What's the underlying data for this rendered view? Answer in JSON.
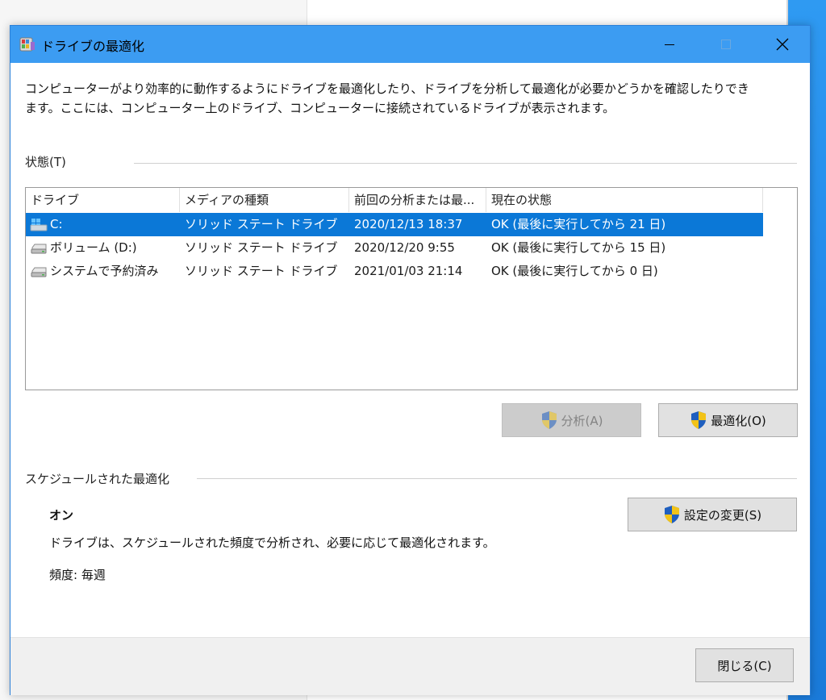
{
  "window": {
    "title": "ドライブの最適化",
    "description": "コンピューターがより効率的に動作するようにドライブを最適化したり、ドライブを分析して最適化が必要かどうかを確認したりできます。ここには、コンピューター上のドライブ、コンピューターに接続されているドライブが表示されます。"
  },
  "status_section": {
    "label": "状態(T)",
    "columns": [
      "ドライブ",
      "メディアの種類",
      "前回の分析または最...",
      "現在の状態"
    ],
    "rows": [
      {
        "drive": "C:",
        "media": "ソリッド ステート ドライブ",
        "last_run": "2020/12/13 18:37",
        "status": "OK (最後に実行してから 21 日)",
        "icon": "windows-drive-icon",
        "selected": true
      },
      {
        "drive": "ボリューム (D:)",
        "media": "ソリッド ステート ドライブ",
        "last_run": "2020/12/20 9:55",
        "status": "OK (最後に実行してから 15 日)",
        "icon": "drive-icon",
        "selected": false
      },
      {
        "drive": "システムで予約済み",
        "media": "ソリッド ステート ドライブ",
        "last_run": "2021/01/03 21:14",
        "status": "OK (最後に実行してから 0 日)",
        "icon": "drive-icon",
        "selected": false
      }
    ]
  },
  "buttons": {
    "analyze": "分析(A)",
    "optimize": "最適化(O)",
    "change_settings": "設定の変更(S)",
    "close": "閉じる(C)"
  },
  "schedule_section": {
    "label": "スケジュールされた最適化",
    "state": "オン",
    "detail": "ドライブは、スケジュールされた頻度で分析され、必要に応じて最適化されます。",
    "frequency": "頻度: 毎週"
  },
  "colors": {
    "titlebar": "#3c9cf2",
    "selection": "#0b78d7",
    "shield_blue": "#1f5fbf",
    "shield_yellow": "#f2c318"
  }
}
